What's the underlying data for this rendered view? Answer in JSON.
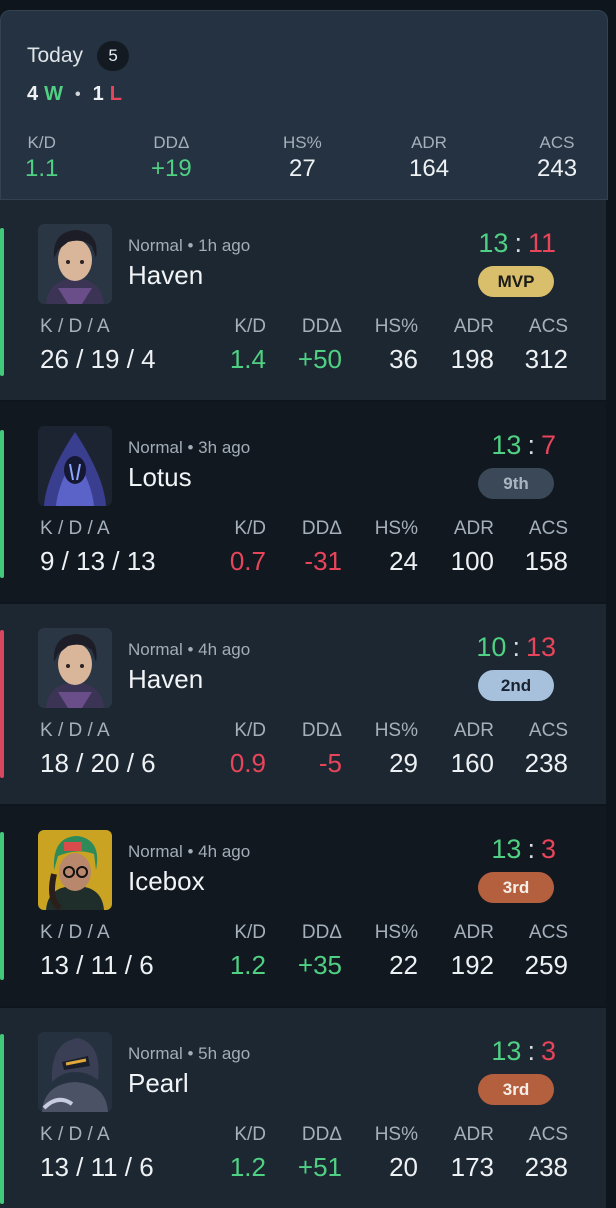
{
  "summary": {
    "title": "Today",
    "count": "5",
    "wins": "4",
    "wins_suffix": "W",
    "dot": "•",
    "losses": "1",
    "losses_suffix": "L",
    "stats": [
      {
        "label": "K/D",
        "value": "1.1"
      },
      {
        "label": "DDΔ",
        "value": "+19"
      },
      {
        "label": "HS%",
        "value": "27"
      },
      {
        "label": "ADR",
        "value": "164"
      },
      {
        "label": "ACS",
        "value": "243"
      }
    ]
  },
  "columns": {
    "kda": "K / D / A",
    "kd": "K/D",
    "dd": "DDΔ",
    "hs": "HS%",
    "adr": "ADR",
    "acs": "ACS"
  },
  "matches": [
    {
      "mode": "Normal • 1h ago",
      "map": "Haven",
      "team_score": "13",
      "enemy_score": "11",
      "result": "win",
      "placement": "MVP",
      "kda": "26 / 19 / 4",
      "kd": "1.4",
      "dd": "+50",
      "hs": "36",
      "adr": "198",
      "acs": "312",
      "agent_icon": "agent-portrait-dark-hair"
    },
    {
      "mode": "Normal • 3h ago",
      "map": "Lotus",
      "team_score": "13",
      "enemy_score": "7",
      "result": "win",
      "placement": "9th",
      "kda": "9 / 13 / 13",
      "kd": "0.7",
      "dd": "-31",
      "hs": "24",
      "adr": "100",
      "acs": "158",
      "agent_icon": "agent-portrait-hooded"
    },
    {
      "mode": "Normal • 4h ago",
      "map": "Haven",
      "team_score": "10",
      "enemy_score": "13",
      "result": "loss",
      "placement": "2nd",
      "kda": "18 / 20 / 6",
      "kd": "0.9",
      "dd": "-5",
      "hs": "29",
      "adr": "160",
      "acs": "238",
      "agent_icon": "agent-portrait-dark-hair"
    },
    {
      "mode": "Normal • 4h ago",
      "map": "Icebox",
      "team_score": "13",
      "enemy_score": "3",
      "result": "win",
      "placement": "3rd",
      "kda": "13 / 11 / 6",
      "kd": "1.2",
      "dd": "+35",
      "hs": "22",
      "adr": "192",
      "acs": "259",
      "agent_icon": "agent-portrait-green-beanie"
    },
    {
      "mode": "Normal • 5h ago",
      "map": "Pearl",
      "team_score": "13",
      "enemy_score": "3",
      "result": "win",
      "placement": "3rd",
      "kda": "13 / 11 / 6",
      "kd": "1.2",
      "dd": "+51",
      "hs": "20",
      "adr": "173",
      "acs": "238",
      "agent_icon": "agent-portrait-armored"
    }
  ],
  "colors": {
    "win": "#4fd083",
    "loss": "#e8455b",
    "card_bg": "#1d2731",
    "card_bg_alt": "#111820"
  }
}
